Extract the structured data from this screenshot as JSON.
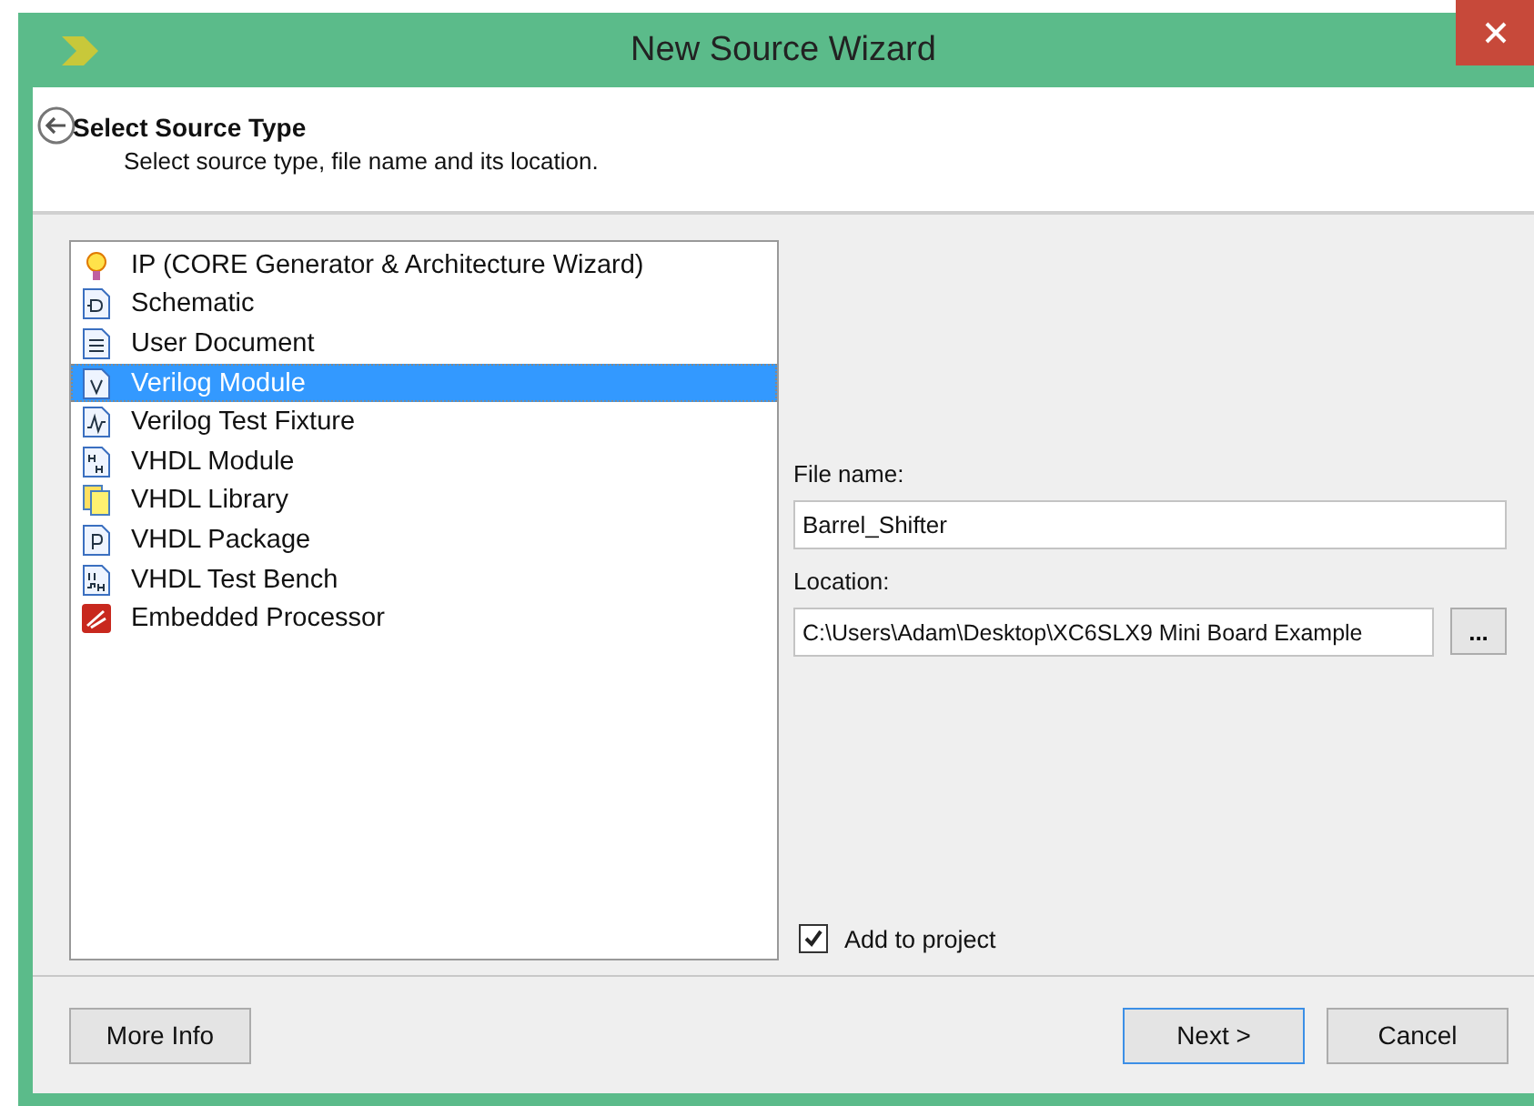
{
  "window": {
    "title": "New Source Wizard"
  },
  "header": {
    "title": "Select Source Type",
    "subtitle": "Select source type, file name and its location."
  },
  "source_types": [
    {
      "label": "IP (CORE Generator & Architecture Wizard)",
      "kind": "ip",
      "selected": false
    },
    {
      "label": "Schematic",
      "kind": "schematic",
      "selected": false
    },
    {
      "label": "User Document",
      "kind": "document",
      "selected": false
    },
    {
      "label": "Verilog Module",
      "kind": "verilog",
      "selected": true
    },
    {
      "label": "Verilog Test Fixture",
      "kind": "fixture",
      "selected": false
    },
    {
      "label": "VHDL Module",
      "kind": "vhdl",
      "selected": false
    },
    {
      "label": "VHDL Library",
      "kind": "library",
      "selected": false
    },
    {
      "label": "VHDL Package",
      "kind": "package",
      "selected": false
    },
    {
      "label": "VHDL Test Bench",
      "kind": "bench",
      "selected": false
    },
    {
      "label": "Embedded Processor",
      "kind": "processor",
      "selected": false
    }
  ],
  "file_name": {
    "label": "File name:",
    "value": "Barrel_Shifter"
  },
  "location": {
    "label": "Location:",
    "value": "C:\\Users\\Adam\\Desktop\\XC6SLX9 Mini Board Example",
    "browse": "..."
  },
  "add_to_project": {
    "label": "Add to project",
    "checked": true
  },
  "buttons": {
    "more_info": "More Info",
    "next": "Next >",
    "cancel": "Cancel"
  }
}
